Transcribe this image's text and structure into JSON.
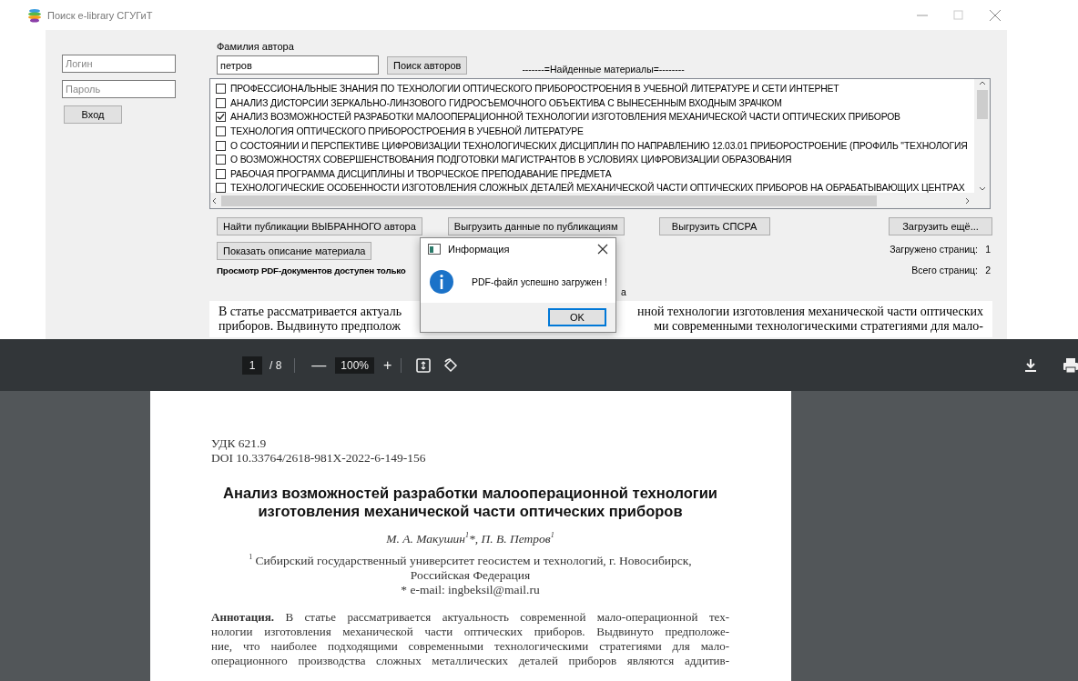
{
  "window": {
    "title": "Поиск e-library СГУГиТ"
  },
  "login": {
    "login_placeholder": "Логин",
    "password_placeholder": "Пароль",
    "button": "Вход"
  },
  "author_search": {
    "label": "Фамилия автора",
    "value": "петров",
    "button": "Поиск авторов"
  },
  "materials": {
    "heading": "-------=Найденные материалы=--------",
    "items": [
      {
        "title": "ПРОФЕССИОНАЛЬНЫЕ ЗНАНИЯ ПО ТЕХНОЛОГИИ ОПТИЧЕСКОГО ПРИБОРОСТРОЕНИЯ В УЧЕБНОЙ ЛИТЕРАТУРЕ И СЕТИ ИНТЕРНЕТ",
        "checked": false
      },
      {
        "title": "АНАЛИЗ ДИСТОРСИИ ЗЕРКАЛЬНО-ЛИНЗОВОГО ГИДРОСЪЕМОЧНОГО ОБЪЕКТИВА С ВЫНЕСЕННЫМ ВХОДНЫМ ЗРАЧКОМ",
        "checked": false
      },
      {
        "title": "АНАЛИЗ ВОЗМОЖНОСТЕЙ РАЗРАБОТКИ МАЛООПЕРАЦИОННОЙ ТЕХНОЛОГИИ ИЗГОТОВЛЕНИЯ МЕХАНИЧЕСКОЙ ЧАСТИ ОПТИЧЕСКИХ ПРИБОРОВ",
        "checked": true
      },
      {
        "title": "ТЕХНОЛОГИЯ ОПТИЧЕСКОГО ПРИБОРОСТРОЕНИЯ В УЧЕБНОЙ ЛИТЕРАТУРЕ",
        "checked": false
      },
      {
        "title": "О СОСТОЯНИИ И ПЕРСПЕКТИВЕ ЦИФРОВИЗАЦИИ ТЕХНОЛОГИЧЕСКИХ ДИСЦИПЛИН ПО НАПРАВЛЕНИЮ 12.03.01 ПРИБОРОСТРОЕНИЕ (ПРОФИЛЬ \"ТЕХНОЛОГИЯ",
        "checked": false
      },
      {
        "title": "О ВОЗМОЖНОСТЯХ СОВЕРШЕНСТВОВАНИЯ ПОДГОТОВКИ МАГИСТРАНТОВ В УСЛОВИЯХ ЦИФРОВИЗАЦИИ ОБРАЗОВАНИЯ",
        "checked": false
      },
      {
        "title": "РАБОЧАЯ ПРОГРАММА ДИСЦИПЛИНЫ И ТВОРЧЕСКОЕ ПРЕПОДАВАНИЕ ПРЕДМЕТА",
        "checked": false
      },
      {
        "title": "ТЕХНОЛОГИЧЕСКИЕ ОСОБЕННОСТИ ИЗГОТОВЛЕНИЯ СЛОЖНЫХ ДЕТАЛЕЙ МЕХАНИЧЕСКОЙ ЧАСТИ ОПТИЧЕСКИХ ПРИБОРОВ НА ОБРАБАТЫВАЮЩИХ ЦЕНТРАХ",
        "checked": false
      }
    ]
  },
  "actions": {
    "find_publications": "Найти публикации ВЫБРАННОГО автора",
    "export_publications": "Выгрузить данные по публикациям",
    "export_spsra": "Выгрузить СПСРА",
    "load_more": "Загрузить ещё...",
    "show_description": "Показать описание материала"
  },
  "pages": {
    "loaded_label": "Загружено страниц:",
    "loaded_value": "1",
    "total_label": "Всего страниц:",
    "total_value": "2"
  },
  "pdf_notice": "Просмотр PDF-документов доступен только",
  "notice_fragment": "а",
  "description_lines": [
    {
      "left": "В статье рассматривается актуаль",
      "right": "нной технологии изготовления механической части оптических"
    },
    {
      "left": "приборов. Выдвинуто предполож",
      "right": "ми современными технологическими стратегиями для мало-"
    }
  ],
  "dialog": {
    "title": "Информация",
    "message": "PDF-файл успешно загружен !",
    "button": "OK"
  },
  "pdf_viewer": {
    "page": "1",
    "page_count": "/ 8",
    "zoom": "100%",
    "minus": "—",
    "plus": "+",
    "page_content": {
      "udk": "УДК 621.9",
      "doi": "DOI 10.33764/2618-981X-2022-6-149-156",
      "title": "Анализ возможностей разработки малооперационной технологии изготовления механической части оптических приборов",
      "authors": "М. А. Макушин$^{1}$*, П. В. Петров$^{1}$",
      "affiliation": "$^{1}$ Сибирский государственный университет геосистем и технологий, г. Новосибирск, Российская Федерация",
      "email": "* e-mail: ingbeksil@mail.ru",
      "abstract_lines": [
        "**Аннотация.** В статье рассматривается актуальность современной мало-операционной тех-",
        "нологии изготовления механической части оптических приборов. Выдвинуто предположе-",
        "ние, что наиболее подходящими современными технологическими стратегиями для мало-",
        "операционного производства сложных металлических деталей приборов являются аддитив-"
      ]
    }
  }
}
